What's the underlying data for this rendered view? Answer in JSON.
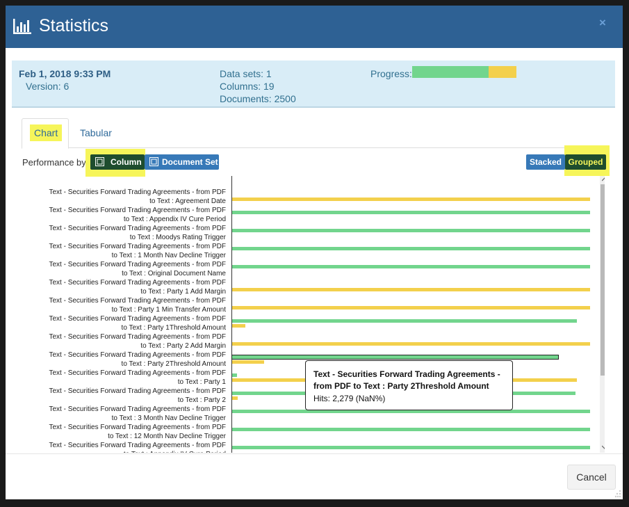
{
  "dialog": {
    "title": "Statistics",
    "title_icon": "bar-chart-icon",
    "close_label": "×"
  },
  "info": {
    "date": "Feb 1, 2018 9:33 PM",
    "version": "Version: 6",
    "data_sets": "Data sets: 1",
    "columns": "Columns: 19",
    "documents": "Documents: 2500",
    "progress_label": "Progress:",
    "progress": {
      "green_fraction": 0.733,
      "yellow_fraction": 0.267
    }
  },
  "tabs": [
    {
      "label": "Chart",
      "active": true
    },
    {
      "label": "Tabular",
      "active": false
    }
  ],
  "performance": {
    "label": "Performance by:",
    "column_btn": "Column",
    "docset_btn": "Document Set",
    "stacked_btn": "Stacked",
    "grouped_btn": "Grouped"
  },
  "colors": {
    "header": "#2e6194",
    "green": "#72d58d",
    "yellow": "#f3d04c",
    "highlight": "#f6f55a",
    "btn_blue": "#3779b8",
    "btn_dark": "#1e4d2e"
  },
  "chart_data": {
    "type": "bar",
    "orientation": "horizontal",
    "grouped": true,
    "categories": [
      "Text - Securities Forward Trading Agreements - from PDF to Text : Agreement Date",
      "Text - Securities Forward Trading Agreements - from PDF to Text : Appendix IV Cure Period",
      "Text - Securities Forward Trading Agreements - from PDF to Text : Moodys Rating Trigger",
      "Text - Securities Forward Trading Agreements - from PDF to Text : 1 Month Nav Decline Trigger",
      "Text - Securities Forward Trading Agreements - from PDF to Text : Original Document Name",
      "Text - Securities Forward Trading Agreements - from PDF to Text : Party 1 Add Margin",
      "Text - Securities Forward Trading Agreements - from PDF to Text : Party 1 Min Transfer Amount",
      "Text - Securities Forward Trading Agreements - from PDF to Text : Party 1Threshold Amount",
      "Text - Securities Forward Trading Agreements - from PDF to Text : Party 2 Add Margin",
      "Text - Securities Forward Trading Agreements - from PDF to Text : Party 2Threshold Amount",
      "Text - Securities Forward Trading Agreements - from PDF to Text : Party 1",
      "Text - Securities Forward Trading Agreements - from PDF to Text : Party 2",
      "Text - Securities Forward Trading Agreements - from PDF to Text : 3 Month Nav Decline Trigger",
      "Text - Securities Forward Trading Agreements - from PDF to Text : 12 Month Nav Decline Trigger",
      "Text - Securities Forward Trading Agreements - from PDF to Text : Appendix IV Cure Period"
    ],
    "label_lines": [
      [
        "Text - Securities Forward Trading Agreements - from PDF",
        "to Text : Agreement Date"
      ],
      [
        "Text - Securities Forward Trading Agreements - from PDF",
        "to Text : Appendix IV Cure Period"
      ],
      [
        "Text - Securities Forward Trading Agreements - from PDF",
        "to Text : Moodys Rating Trigger"
      ],
      [
        "Text - Securities Forward Trading Agreements - from PDF",
        "to Text : 1 Month Nav Decline Trigger"
      ],
      [
        "Text - Securities Forward Trading Agreements - from PDF",
        "to Text : Original Document Name"
      ],
      [
        "Text - Securities Forward Trading Agreements - from PDF",
        "to Text : Party 1 Add Margin"
      ],
      [
        "Text - Securities Forward Trading Agreements - from PDF",
        "to Text : Party 1 Min Transfer Amount"
      ],
      [
        "Text - Securities Forward Trading Agreements - from PDF",
        "to Text : Party 1Threshold Amount"
      ],
      [
        "Text - Securities Forward Trading Agreements - from PDF",
        "to Text : Party 2 Add Margin"
      ],
      [
        "Text - Securities Forward Trading Agreements - from PDF",
        "to Text : Party 2Threshold Amount"
      ],
      [
        "Text - Securities Forward Trading Agreements - from PDF",
        "to Text : Party 1"
      ],
      [
        "Text - Securities Forward Trading Agreements - from PDF",
        "to Text : Party 2"
      ],
      [
        "Text - Securities Forward Trading Agreements - from PDF",
        "to Text : 3 Month Nav Decline Trigger"
      ],
      [
        "Text - Securities Forward Trading Agreements - from PDF",
        "to Text : 12 Month Nav Decline Trigger"
      ],
      [
        "Text - Securities Forward Trading Agreements - from PDF",
        "to Text : Appendix IV Cure Period"
      ]
    ],
    "series": [
      {
        "color": "#72d58d",
        "values": [
          0,
          2500,
          2500,
          2500,
          2500,
          0,
          0,
          2410,
          0,
          2279,
          35,
          2400,
          2500,
          2500,
          2500
        ]
      },
      {
        "color": "#f3d04c",
        "values": [
          2500,
          0,
          0,
          0,
          0,
          2500,
          2500,
          90,
          2500,
          221,
          2410,
          40,
          0,
          0,
          0
        ]
      }
    ],
    "xlim": [
      0,
      2500
    ],
    "highlighted_index": 9
  },
  "tooltip": {
    "title": "Text - Securities Forward Trading Agreements - from PDF to Text : Party 2Threshold Amount",
    "hits": "Hits: 2,279 (NaN%)"
  },
  "footer": {
    "cancel_label": "Cancel"
  }
}
